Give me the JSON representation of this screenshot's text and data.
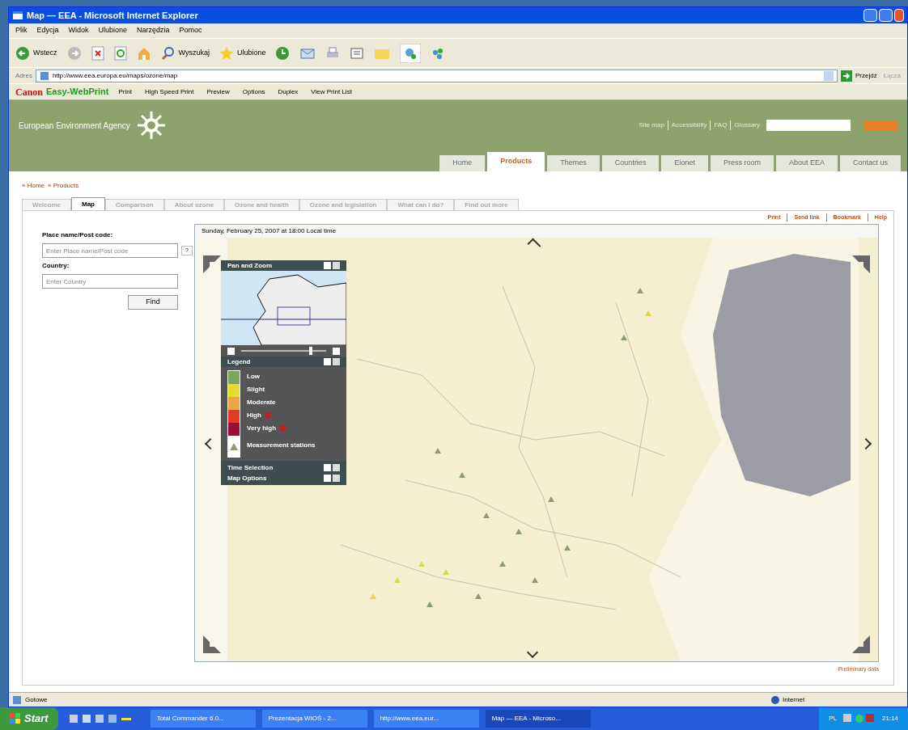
{
  "window": {
    "title": "Map — EEA - Microsoft Internet Explorer"
  },
  "menu": [
    "Plik",
    "Edycja",
    "Widok",
    "Ulubione",
    "Narzędzia",
    "Pomoc"
  ],
  "toolbar": {
    "back": "Wstecz",
    "search": "Wyszukaj",
    "favorites": "Ulubione"
  },
  "address": {
    "label": "Adres",
    "url": "http://www.eea.europa.eu/maps/ozone/map",
    "go": "Przejdź",
    "links": "Łącza"
  },
  "print_bar": {
    "brand": "Canon",
    "product": "Easy-WebPrint",
    "buttons": [
      "Print",
      "High Speed Print",
      "Preview",
      "Options",
      "Duplex",
      "View Print List"
    ]
  },
  "site": {
    "name": "European Environment Agency",
    "top_links": [
      "Site map",
      "Accessibility",
      "FAQ",
      "Glossary"
    ],
    "nav_tabs": [
      {
        "label": "Home",
        "selected": false
      },
      {
        "label": "Products",
        "selected": true
      },
      {
        "label": "Themes",
        "selected": false
      },
      {
        "label": "Countries",
        "selected": false
      },
      {
        "label": "Eionet",
        "selected": false
      },
      {
        "label": "Press room",
        "selected": false
      },
      {
        "label": "About EEA",
        "selected": false
      },
      {
        "label": "Contact us",
        "selected": false
      }
    ]
  },
  "breadcrumb": [
    "» Home",
    "» Products"
  ],
  "sub_tabs": [
    {
      "label": "Welcome",
      "selected": false
    },
    {
      "label": "Map",
      "selected": true
    },
    {
      "label": "Comparison",
      "selected": false
    },
    {
      "label": "About ozone",
      "selected": false
    },
    {
      "label": "Ozone and health",
      "selected": false
    },
    {
      "label": "Ozone and legislation",
      "selected": false
    },
    {
      "label": "What can I do?",
      "selected": false
    },
    {
      "label": "Find out more",
      "selected": false
    }
  ],
  "actions": [
    "Print",
    "Send link",
    "Bookmark",
    "Help"
  ],
  "search_form": {
    "place_label": "Place name/Post code:",
    "place_placeholder": "Enter Place name/Post code",
    "help": "?",
    "country_label": "Country:",
    "country_placeholder": "Enter Country",
    "button": "Find"
  },
  "map": {
    "timestamp": "Sunday, February 25, 2007 at 18:00 Local time",
    "pan_zoom": {
      "title": "Pan and Zoom",
      "level": 0.8
    },
    "legend": {
      "title": "Legend",
      "items": [
        {
          "label": "Low",
          "color": "#7ea35d",
          "alert": false
        },
        {
          "label": "Slight",
          "color": "#e6dc30",
          "alert": false
        },
        {
          "label": "Moderate",
          "color": "#f0a545",
          "alert": false
        },
        {
          "label": "High",
          "color": "#e03a2a",
          "alert": true
        },
        {
          "label": "Very high",
          "color": "#9a1035",
          "alert": true
        }
      ],
      "stations": "Measurement stations"
    },
    "sections": [
      "Time Selection",
      "Map Options"
    ],
    "note": "Preliminary data"
  },
  "status_bar": {
    "text": "Gotowe",
    "zone": "Internet"
  },
  "taskbar": {
    "start": "Start",
    "tasks": [
      {
        "label": "Total Commander 6.0...",
        "selected": false
      },
      {
        "label": "Prezentacja WIOŚ - 2...",
        "selected": false
      },
      {
        "label": "http://www.eea.eur...",
        "selected": false
      },
      {
        "label": "Map — EEA - Microso...",
        "selected": true
      }
    ],
    "lang": "PL",
    "clock": "21:14"
  }
}
